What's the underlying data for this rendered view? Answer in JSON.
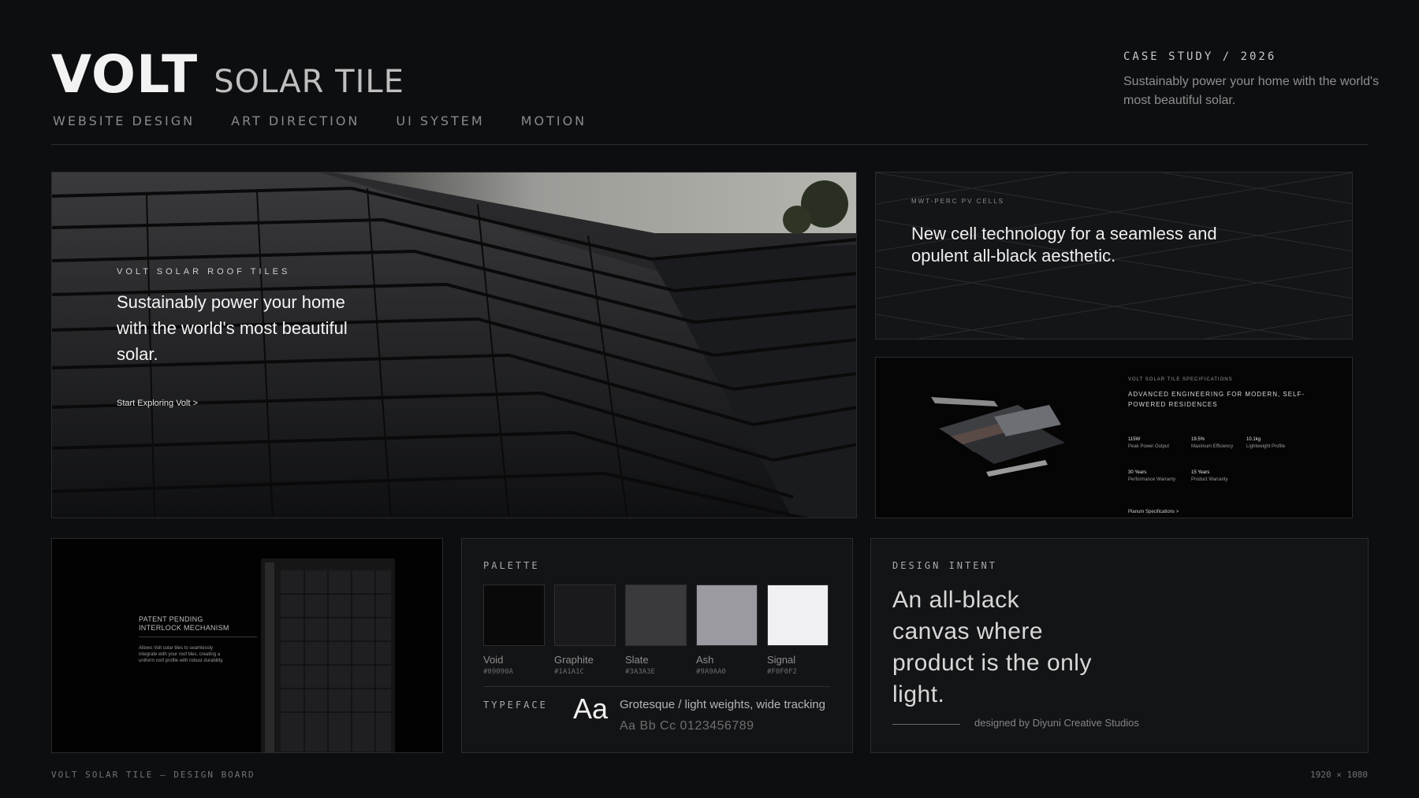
{
  "header": {
    "brand": "VOLT",
    "product": "SOLAR TILE",
    "disciplines": [
      "WEBSITE DESIGN",
      "ART DIRECTION",
      "UI SYSTEM",
      "MOTION"
    ],
    "case_label": "CASE STUDY / 2026",
    "case_description": "Sustainably power your home with the world's most beautiful solar."
  },
  "hero": {
    "eyebrow": "VOLT SOLAR ROOF TILES",
    "title": "Sustainably power your home with the world's most beautiful solar.",
    "cta": "Start Exploring Volt >"
  },
  "pv_card": {
    "eyebrow": "MWT-PERC PV CELLS",
    "title": "New cell technology for a seamless and opulent all-black aesthetic."
  },
  "specs_card": {
    "eyebrow": "VOLT SOLAR TILE SPECIFICATIONS",
    "title": "ADVANCED ENGINEERING FOR MODERN, SELF-POWERED RESIDENCES",
    "items": [
      {
        "value": "115W",
        "label": "Peak Power Output"
      },
      {
        "value": "19.5%",
        "label": "Maximum Efficiency"
      },
      {
        "value": "10.1kg",
        "label": "Lightweight Profile"
      },
      {
        "value": "30 Years",
        "label": "Performance Warranty"
      },
      {
        "value": "15 Years",
        "label": "Product Warranty"
      }
    ],
    "link": "Planum Specifications >"
  },
  "patent_card": {
    "title_line1": "PATENT PENDING",
    "title_line2": "INTERLOCK MECHANISM",
    "description": "Allows Volt solar tiles to seamlessly integrate with your roof tiles, creating a uniform roof profile with robust durability."
  },
  "palette": {
    "label": "PALETTE",
    "swatches": [
      {
        "name": "Void",
        "hex": "#09090A"
      },
      {
        "name": "Graphite",
        "hex": "#1A1A1C"
      },
      {
        "name": "Slate",
        "hex": "#3A3A3E"
      },
      {
        "name": "Ash",
        "hex": "#9A9AA0"
      },
      {
        "name": "Signal",
        "hex": "#F0F0F2"
      }
    ],
    "typeface_label": "TYPEFACE",
    "typeface_glyph": "Aa",
    "typeface_desc": "Grotesque / light weights, wide tracking",
    "typeface_sample": "Aa Bb Cc  0123456789"
  },
  "intent": {
    "label": "DESIGN INTENT",
    "title": "An all-black canvas where product is the only light.",
    "credit": "designed by Diyuni Creative Studios"
  },
  "footer": {
    "left": "VOLT SOLAR TILE  —  DESIGN BOARD",
    "right": "1920 × 1080"
  }
}
